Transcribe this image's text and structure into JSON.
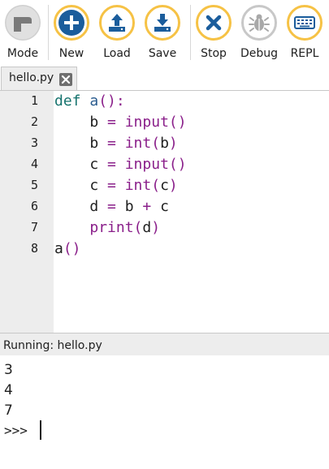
{
  "toolbar": {
    "buttons": [
      {
        "label": "Mode",
        "icon": "mode-icon"
      },
      {
        "label": "New",
        "icon": "plus-icon"
      },
      {
        "label": "Load",
        "icon": "upload-icon"
      },
      {
        "label": "Save",
        "icon": "download-icon"
      },
      {
        "label": "Stop",
        "icon": "close-icon"
      },
      {
        "label": "Debug",
        "icon": "bug-icon"
      },
      {
        "label": "REPL",
        "icon": "keyboard-icon"
      }
    ],
    "accent_color": "#f6c245",
    "icon_color": "#1b5d9c",
    "disabled_color": "#c8c8c8"
  },
  "tabs": [
    {
      "label": "hello.py",
      "close_icon": "close-icon"
    }
  ],
  "editor": {
    "line_numbers": [
      "1",
      "2",
      "3",
      "4",
      "5",
      "6",
      "7",
      "8"
    ],
    "lines": [
      "def a():",
      "    b = input()",
      "    b = int(b)",
      "    c = input()",
      "    c = int(c)",
      "    d = b + c",
      "    print(d)",
      "a()"
    ]
  },
  "status": {
    "text": "Running: hello.py"
  },
  "console": {
    "output": [
      "3",
      "4",
      "7"
    ],
    "prompt": ">>> "
  }
}
